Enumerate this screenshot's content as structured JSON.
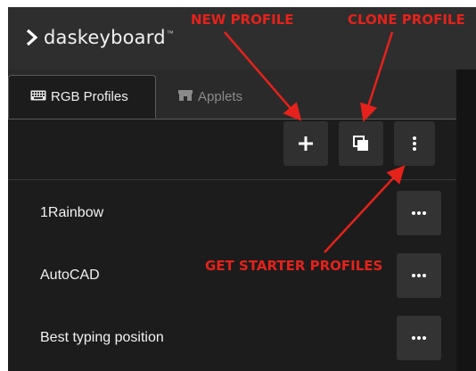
{
  "app": {
    "logo_text": "daskeyboard",
    "trademark": "™"
  },
  "tabs": [
    {
      "label": "RGB Profiles",
      "icon": "keyboard-icon",
      "active": true
    },
    {
      "label": "Applets",
      "icon": "store-icon",
      "active": false
    }
  ],
  "toolbar": {
    "new_icon": "plus-icon",
    "clone_icon": "clone-icon",
    "more_icon": "vertical-ellipsis-icon"
  },
  "profiles": [
    {
      "name": "1Rainbow"
    },
    {
      "name": "AutoCAD"
    },
    {
      "name": "Best typing position"
    }
  ],
  "annotations": {
    "new_profile": "NEW PROFILE",
    "clone_profile": "CLONE PROFILE",
    "get_starter_profiles": "GET STARTER PROFILES",
    "color": "#e4221b"
  }
}
